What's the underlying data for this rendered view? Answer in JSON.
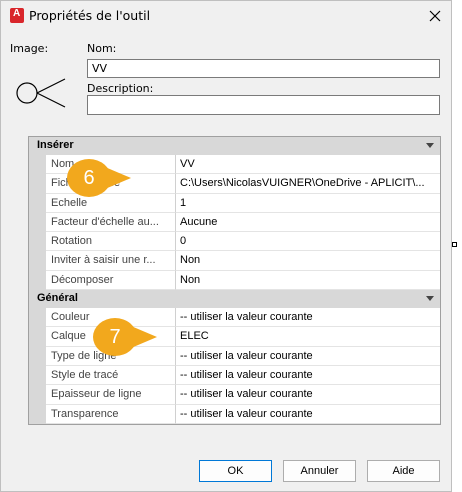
{
  "window": {
    "title": "Propriétés de l'outil"
  },
  "top": {
    "image_label": "Image:",
    "name_label": "Nom:",
    "name_value": "VV",
    "description_label": "Description:",
    "description_value": ""
  },
  "sections": {
    "inserer": {
      "title": "Insérer",
      "rows": [
        {
          "name": "Nom",
          "value": "VV"
        },
        {
          "name": "Fichier source",
          "value": "C:\\Users\\NicolasVUIGNER\\OneDrive - APLICIT\\..."
        },
        {
          "name": "Echelle",
          "value": "1"
        },
        {
          "name": "Facteur d'échelle au...",
          "value": "Aucune"
        },
        {
          "name": "Rotation",
          "value": "0"
        },
        {
          "name": "Inviter à saisir une r...",
          "value": "Non"
        },
        {
          "name": "Décomposer",
          "value": "Non"
        }
      ]
    },
    "general": {
      "title": "Général",
      "rows": [
        {
          "name": "Couleur",
          "value": "-- utiliser la valeur courante"
        },
        {
          "name": "Calque",
          "value": "ELEC"
        },
        {
          "name": "Type de ligne",
          "value": "-- utiliser la valeur courante"
        },
        {
          "name": "Style de tracé",
          "value": "-- utiliser la valeur courante"
        },
        {
          "name": "Epaisseur de ligne",
          "value": "-- utiliser la valeur courante"
        },
        {
          "name": "Transparence",
          "value": "-- utiliser la valeur courante"
        }
      ]
    }
  },
  "callouts": {
    "six": "6",
    "seven": "7"
  },
  "buttons": {
    "ok": "OK",
    "cancel": "Annuler",
    "help": "Aide"
  },
  "colors": {
    "callout": "#f2a81d",
    "category_bg": "#d8d8d8",
    "app_icon": "#d9262b"
  }
}
